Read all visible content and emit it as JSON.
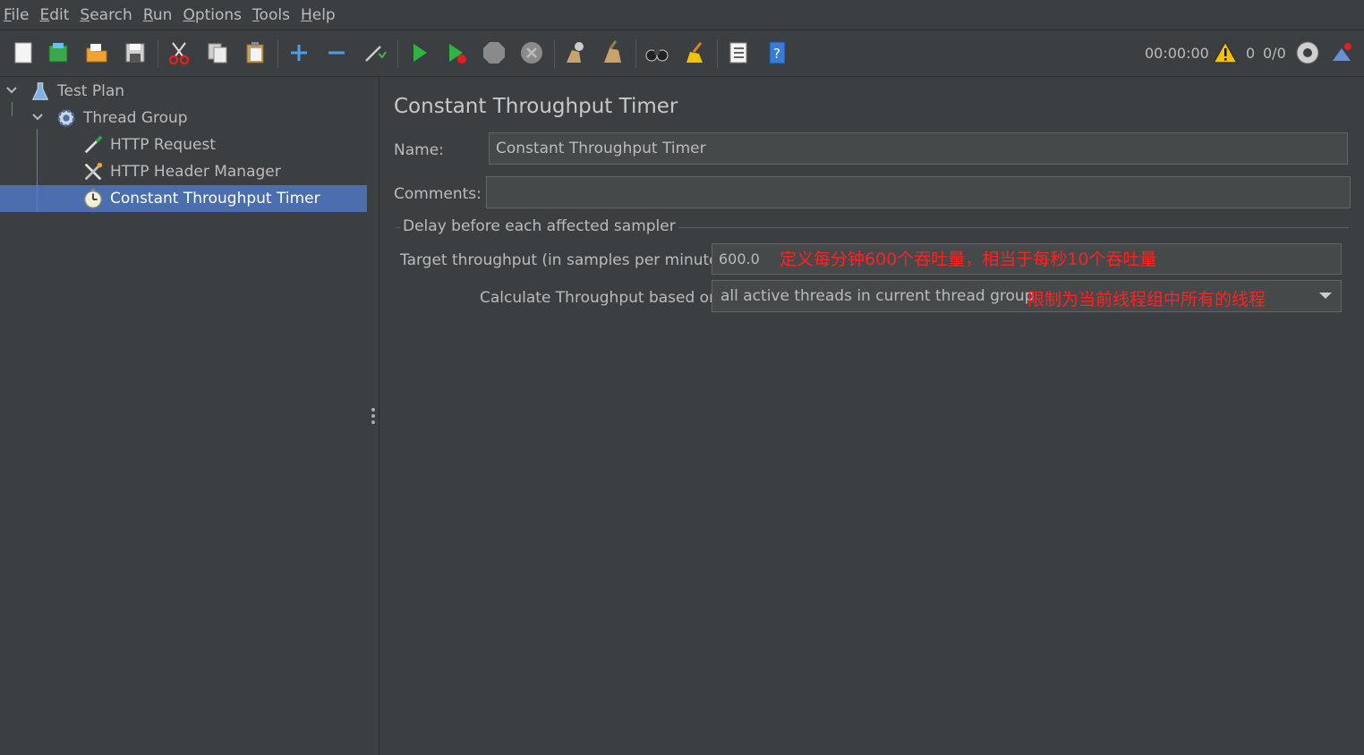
{
  "menu": {
    "items": [
      {
        "mnemonic": "F",
        "rest": "ile"
      },
      {
        "mnemonic": "E",
        "rest": "dit"
      },
      {
        "mnemonic": "S",
        "rest": "earch"
      },
      {
        "mnemonic": "R",
        "rest": "un"
      },
      {
        "mnemonic": "O",
        "rest": "ptions"
      },
      {
        "mnemonic": "T",
        "rest": "ools"
      },
      {
        "mnemonic": "H",
        "rest": "elp"
      }
    ]
  },
  "status": {
    "timer": "00:00:00",
    "warnings": "0",
    "threads": "0/0"
  },
  "tree": {
    "items": [
      {
        "label": "Test Plan",
        "icon": "flask-icon"
      },
      {
        "label": "Thread Group",
        "icon": "gear-icon"
      },
      {
        "label": "HTTP Request",
        "icon": "pipette-icon"
      },
      {
        "label": "HTTP Header Manager",
        "icon": "wrench-screwdriver-icon"
      },
      {
        "label": "Constant Throughput Timer",
        "icon": "stopwatch-icon"
      }
    ],
    "selected": "Constant Throughput Timer"
  },
  "panel": {
    "title": "Constant Throughput Timer",
    "name_label": "Name:",
    "name_value": "Constant Throughput Timer",
    "comments_label": "Comments:",
    "comments_value": "",
    "group_title": "Delay before each affected sampler",
    "throughput_label": "Target throughput (in samples per minute):",
    "throughput_value": "600.0",
    "throughput_note": "定义每分钟600个吞吐量，相当于每秒10个吞吐量",
    "calc_label": "Calculate Throughput based on:",
    "calc_value": "all active threads in current thread group",
    "calc_note": "限制为当前线程组中所有的线程"
  },
  "colors": {
    "background": "#3c3f41",
    "selection": "#4b6eaf",
    "annotation": "#ff2222",
    "text": "#bbbbbb"
  }
}
